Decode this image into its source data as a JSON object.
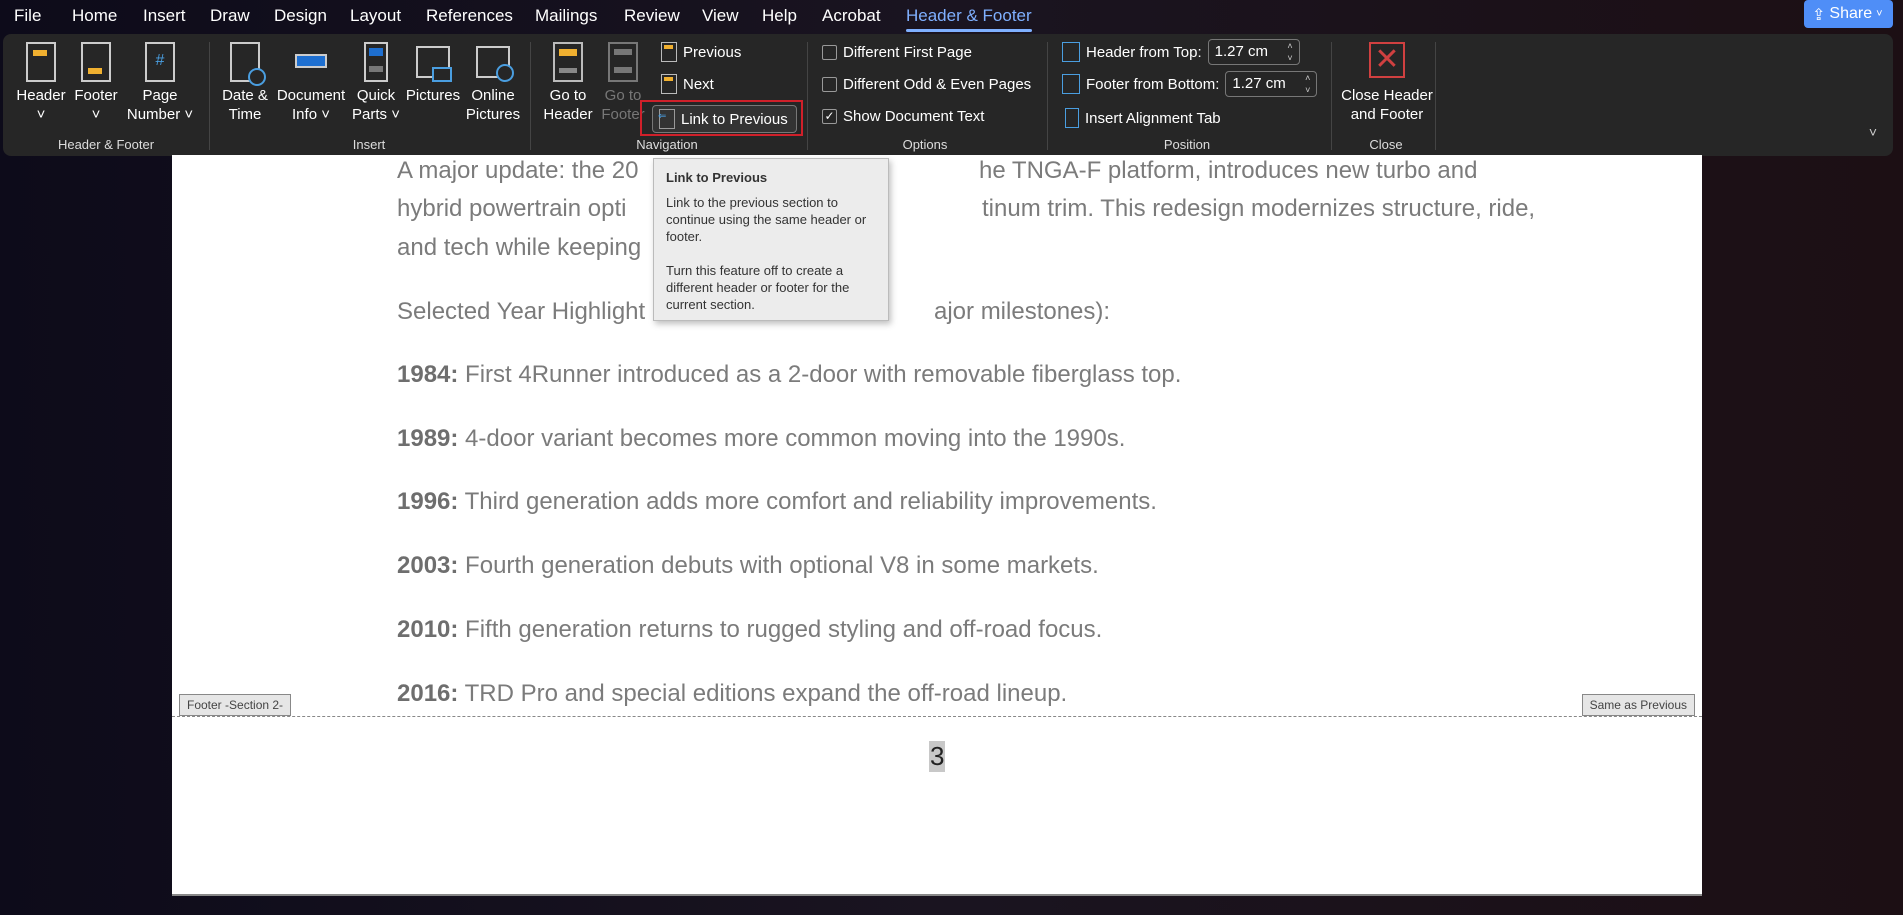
{
  "menu": {
    "tabs": [
      "File",
      "Home",
      "Insert",
      "Draw",
      "Design",
      "Layout",
      "References",
      "Mailings",
      "Review",
      "View",
      "Help",
      "Acrobat",
      "Header & Footer"
    ],
    "active": "Header & Footer",
    "share": "Share"
  },
  "ribbon": {
    "groups": [
      "Header & Footer",
      "Insert",
      "Navigation",
      "Options",
      "Position",
      "Close"
    ],
    "header": [
      "Header",
      "˅"
    ],
    "footer": [
      "Footer",
      "˅"
    ],
    "page_number": [
      "Page",
      "Number ˅"
    ],
    "date_time": [
      "Date &",
      "Time"
    ],
    "document_info": [
      "Document",
      "Info ˅"
    ],
    "quick_parts": [
      "Quick",
      "Parts ˅"
    ],
    "pictures": [
      "Pictures",
      ""
    ],
    "online_pictures": [
      "Online",
      "Pictures"
    ],
    "go_to_header": [
      "Go to",
      "Header"
    ],
    "go_to_footer": [
      "Go to",
      "Footer"
    ],
    "previous": "Previous",
    "next": "Next",
    "link_to_previous": "Link to Previous",
    "different_first_page": "Different First Page",
    "different_odd_even": "Different Odd & Even Pages",
    "show_document_text": "Show Document Text",
    "options_checked": {
      "different_first_page": false,
      "different_odd_even": false,
      "show_document_text": true
    },
    "header_from_top_label": "Header from Top:",
    "header_from_top": "1.27 cm",
    "footer_from_bottom_label": "Footer from Bottom:",
    "footer_from_bottom": "1.27 cm",
    "insert_alignment_tab": "Insert Alignment Tab",
    "close": [
      "Close Header",
      "and Footer"
    ]
  },
  "tooltip": {
    "title": "Link to Previous",
    "line1": "Link to the previous section to continue using the same header or footer.",
    "line2": "Turn this feature off to create a different header or footer for the current section."
  },
  "document": {
    "lines": [
      "A major update: the 20",
      "hybrid powertrain opti",
      "and tech while keeping"
    ],
    "lines_right": [
      "he TNGA-F platform, introduces new turbo and",
      "tinum trim. This redesign modernizes structure, ride,",
      "."
    ],
    "highlights_intro": "Selected Year Highlight",
    "highlights_intro_right": "ajor milestones):",
    "items": [
      {
        "year": "1984:",
        "text": " First 4Runner introduced as a 2-door with removable fiberglass top."
      },
      {
        "year": "1989:",
        "text": " 4-door variant becomes more common moving into the 1990s."
      },
      {
        "year": "1996:",
        "text": " Third generation adds more comfort and reliability improvements."
      },
      {
        "year": "2003:",
        "text": " Fourth generation debuts with optional V8 in some markets."
      },
      {
        "year": "2010:",
        "text": " Fifth generation returns to rugged styling and off-road focus."
      },
      {
        "year": "2016:",
        "text": " TRD Pro and special editions expand the off-road lineup."
      }
    ],
    "footer_tag": "Footer -Section 2-",
    "same_as_previous": "Same as Previous",
    "page_number": "3"
  },
  "colors": {
    "accent": "#7fb0ff",
    "share": "#4f8ef7",
    "highlight_box": "#d0202a"
  }
}
